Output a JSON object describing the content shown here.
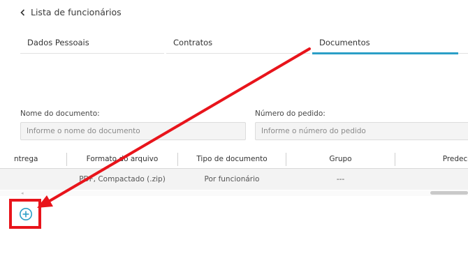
{
  "header": {
    "back_label": "Lista de funcionários"
  },
  "tabs": [
    {
      "label": "Dados Pessoais",
      "active": false
    },
    {
      "label": "Contratos",
      "active": false
    },
    {
      "label": "Documentos",
      "active": true
    }
  ],
  "form": {
    "document_name": {
      "label": "Nome do documento:",
      "placeholder": "Informe o nome do documento",
      "value": ""
    },
    "order_number": {
      "label": "Número do pedido:",
      "placeholder": "Informe o número do pedido",
      "value": ""
    }
  },
  "table": {
    "columns": [
      "ntrega",
      "Formato do arquivo",
      "Tipo de documento",
      "Grupo",
      "Predecessor(e"
    ],
    "rows": [
      {
        "entrega": "",
        "formato": "PDF, Compactado (.zip)",
        "tipo": "Por funcionário",
        "grupo": "---",
        "predecessor": "---"
      }
    ]
  },
  "icons": {
    "back": "chevron-left-icon",
    "add": "plus-circle-icon"
  },
  "colors": {
    "accent": "#2b9fc7",
    "annotation": "#e8141b"
  }
}
